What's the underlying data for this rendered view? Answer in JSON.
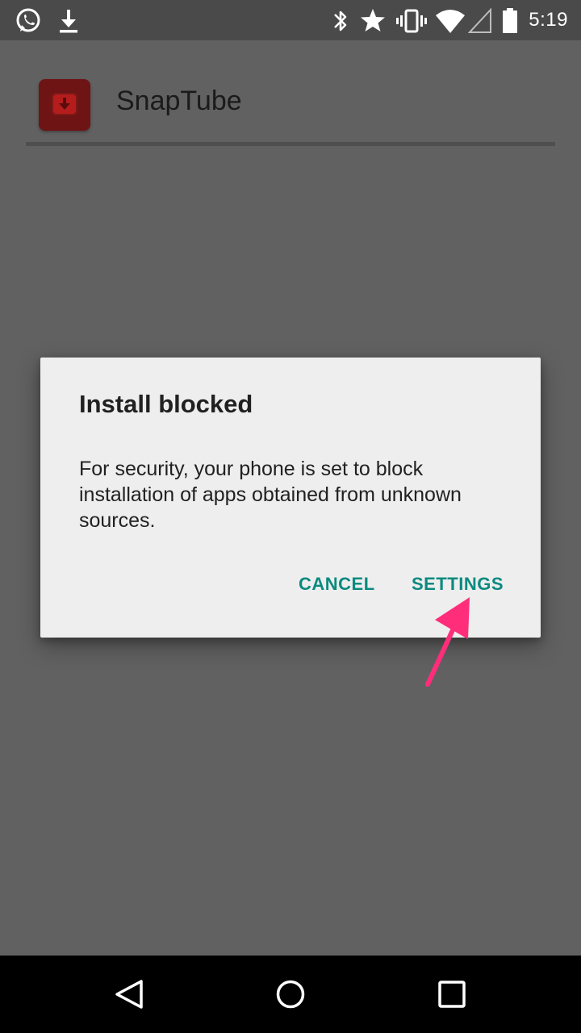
{
  "status_bar": {
    "time": "5:19",
    "left_icons": [
      "whatsapp-icon",
      "download-icon"
    ],
    "right_icons": [
      "bluetooth-icon",
      "star-icon",
      "vibrate-icon",
      "wifi-icon",
      "cell-signal-icon",
      "battery-icon"
    ]
  },
  "app": {
    "name": "SnapTube",
    "icon": "snaptube-app-icon",
    "icon_color": "#b51d1d"
  },
  "dialog": {
    "title": "Install blocked",
    "message": "For security, your phone is set to block installation of apps obtained from unknown sources.",
    "buttons": {
      "cancel": "CANCEL",
      "settings": "SETTINGS"
    },
    "accent_color": "#0b8a7f"
  },
  "annotation": {
    "icon": "pink-arrow-pointer",
    "color": "#ff2d7a"
  },
  "nav_bar": {
    "icons": [
      "back-icon",
      "home-icon",
      "recents-icon"
    ]
  }
}
